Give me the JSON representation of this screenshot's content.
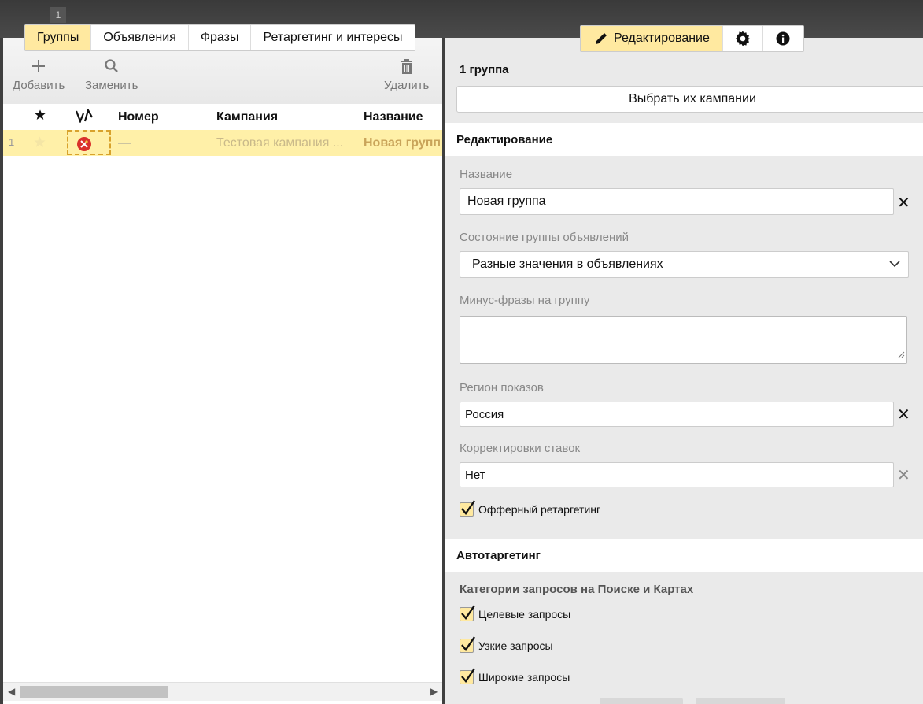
{
  "window": {
    "badge": "1"
  },
  "left": {
    "tabs": [
      {
        "label": "Группы",
        "active": true
      },
      {
        "label": "Объявления"
      },
      {
        "label": "Фразы"
      },
      {
        "label": "Ретаргетинг и интересы"
      }
    ],
    "toolbar": {
      "add": "Добавить",
      "replace": "Заменить",
      "delete": "Удалить"
    },
    "columns": {
      "number": "Номер",
      "campaign": "Кампания",
      "name": "Название"
    },
    "rows": [
      {
        "index": "1",
        "number": "—",
        "campaign": "Тестовая кампания ...",
        "name": "Новая групп"
      }
    ]
  },
  "right": {
    "tabs": {
      "edit": "Редактирование"
    },
    "count": "1 группа",
    "choose_button": "Выбрать их кампании",
    "section_edit": "Редактирование",
    "name_label": "Название",
    "name_value": "Новая группа",
    "state_label": "Состояние группы объявлений",
    "state_value": "Разные значения в объявлениях",
    "minus_label": "Минус-фразы на группу",
    "minus_value": "",
    "region_label": "Регион показов",
    "region_value": "Россия",
    "bid_label": "Корректировки ставок",
    "bid_value": "Нет",
    "offer_retargeting": "Офферный ретаргетинг",
    "section_auto": "Автотаргетинг",
    "categories_label": "Категории запросов на Поиске и Картах",
    "categories": [
      {
        "label": "Целевые запросы",
        "checked": true
      },
      {
        "label": "Узкие запросы",
        "checked": true
      },
      {
        "label": "Широкие запросы",
        "checked": true
      }
    ]
  },
  "colors": {
    "accent": "#ffe9a0",
    "row_selected": "#fff0a8",
    "error": "#d9312b"
  }
}
